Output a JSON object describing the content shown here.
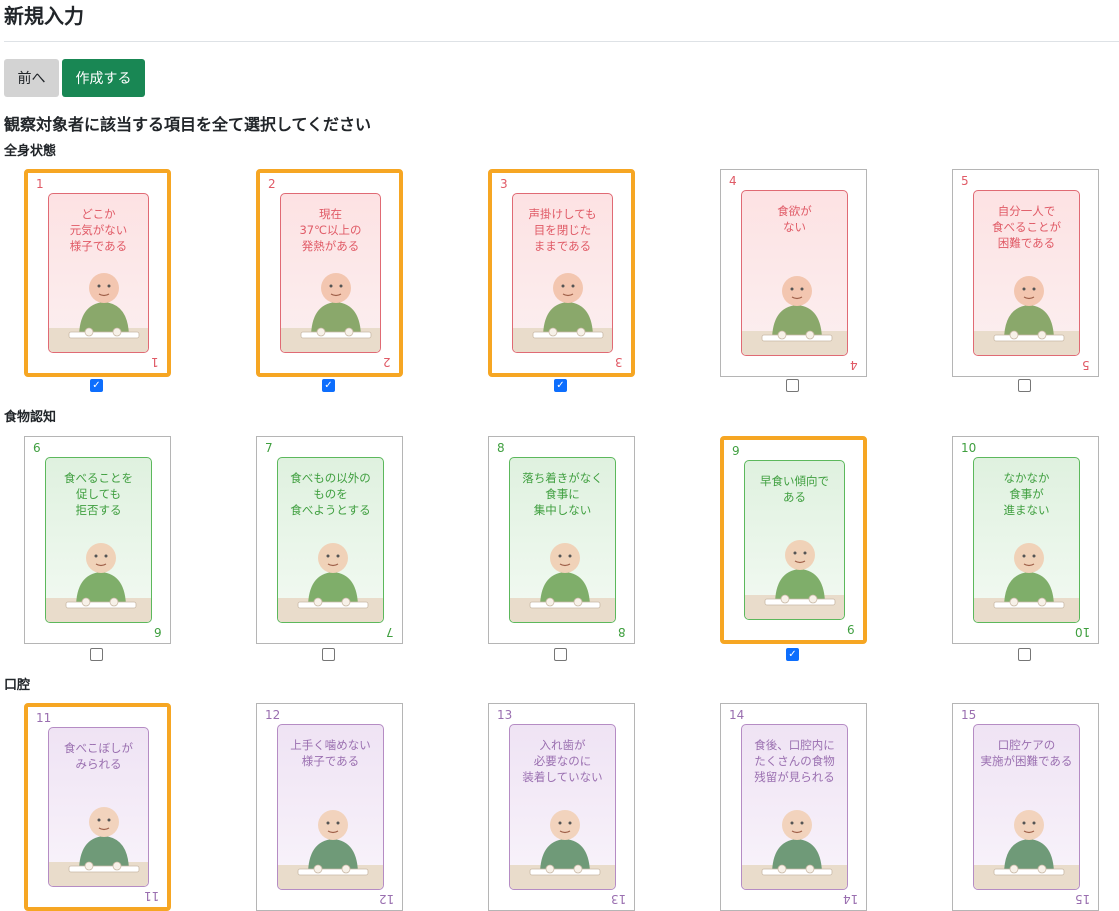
{
  "page": {
    "title": "新規入力"
  },
  "toolbar": {
    "prev_label": "前へ",
    "create_label": "作成する"
  },
  "instruction": "観察対象者に該当する項目を全て選択してください",
  "colors": {
    "selected_border": "#f6a623",
    "create_button": "#198754",
    "checkbox_checked": "#0d6efd"
  },
  "sections": [
    {
      "label": "全身状態",
      "theme": "red",
      "cards": [
        {
          "num": "1",
          "text": "どこか\n元気がない\n様子である",
          "checked": true
        },
        {
          "num": "2",
          "text": "現在\n37℃以上の\n発熱がある",
          "checked": true
        },
        {
          "num": "3",
          "text": "声掛けしても\n目を閉じた\nままである",
          "checked": true
        },
        {
          "num": "4",
          "text": "食欲が\nない",
          "checked": false
        },
        {
          "num": "5",
          "text": "自分一人で\n食べることが\n困難である",
          "checked": false
        }
      ]
    },
    {
      "label": "食物認知",
      "theme": "green",
      "cards": [
        {
          "num": "6",
          "text": "食べることを\n促しても\n拒否する",
          "checked": false
        },
        {
          "num": "7",
          "text": "食べもの以外の\nものを\n食べようとする",
          "checked": false
        },
        {
          "num": "8",
          "text": "落ち着きがなく\n食事に\n集中しない",
          "checked": false
        },
        {
          "num": "9",
          "text": "早食い傾向で\nある",
          "checked": true
        },
        {
          "num": "10",
          "text": "なかなか\n食事が\n進まない",
          "checked": false
        }
      ]
    },
    {
      "label": "口腔",
      "theme": "purple",
      "cards": [
        {
          "num": "11",
          "text": "食べこぼしが\nみられる",
          "checked": true
        },
        {
          "num": "12",
          "text": "上手く噛めない\n様子である",
          "checked": false
        },
        {
          "num": "13",
          "text": "入れ歯が\n必要なのに\n装着していない",
          "checked": false
        },
        {
          "num": "14",
          "text": "食後、口腔内に\nたくさんの食物\n残留が見られる",
          "checked": false
        },
        {
          "num": "15",
          "text": "口腔ケアの\n実施が困難である",
          "checked": false
        }
      ]
    }
  ]
}
